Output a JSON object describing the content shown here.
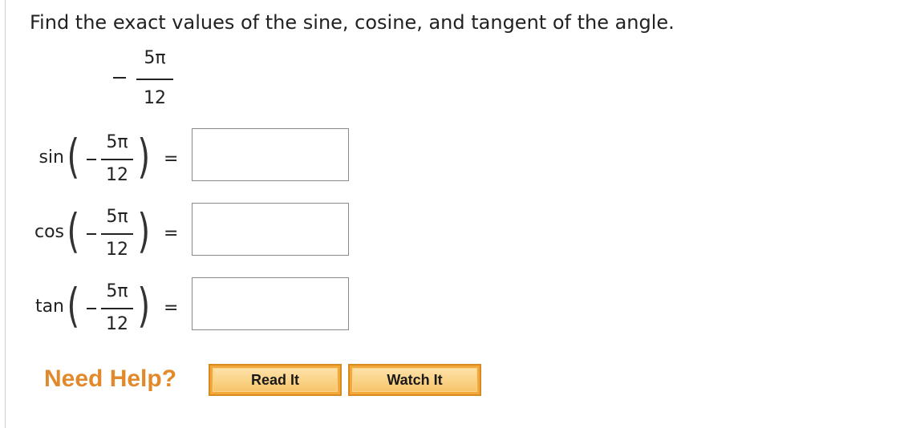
{
  "question": {
    "prompt": "Find the exact values of the sine, cosine, and tangent of the angle.",
    "angle": {
      "sign": "−",
      "numerator": "5π",
      "denominator": "12"
    }
  },
  "rows": [
    {
      "function": "sin",
      "sign": "−",
      "numerator": "5π",
      "denominator": "12",
      "equals": "=",
      "answer": ""
    },
    {
      "function": "cos",
      "sign": "−",
      "numerator": "5π",
      "denominator": "12",
      "equals": "=",
      "answer": ""
    },
    {
      "function": "tan",
      "sign": "−",
      "numerator": "5π",
      "denominator": "12",
      "equals": "=",
      "answer": ""
    }
  ],
  "help": {
    "title": "Need Help?",
    "read_label": "Read It",
    "watch_label": "Watch It"
  }
}
